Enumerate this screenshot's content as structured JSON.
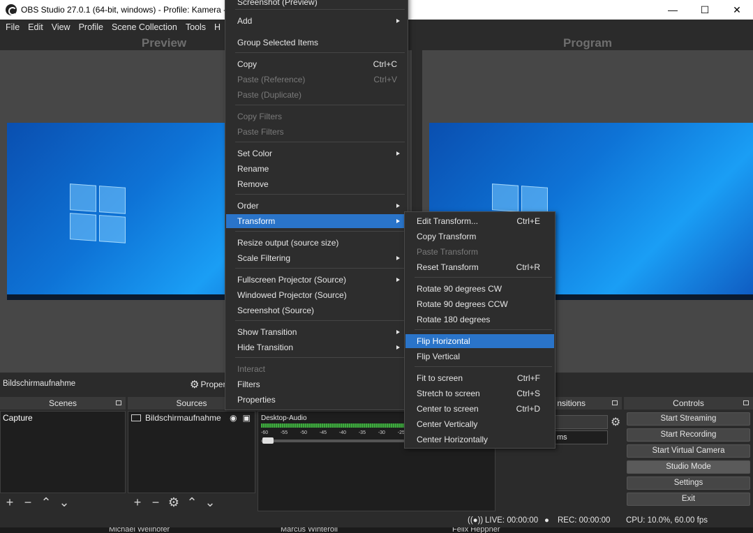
{
  "window": {
    "title": "OBS Studio 27.0.1 (64-bit, windows) - Profile: Kamera - S"
  },
  "menubar": [
    "File",
    "Edit",
    "View",
    "Profile",
    "Scene Collection",
    "Tools",
    "H"
  ],
  "panels": {
    "preview": "Preview",
    "program": "Program"
  },
  "scene_bar": {
    "scene_name": "Bildschirmaufnahme",
    "properties": "Proper"
  },
  "docks": {
    "scenes": {
      "title": "Scenes",
      "items": [
        "Capture"
      ]
    },
    "sources": {
      "title": "Sources",
      "items": [
        "Bildschirmaufnahme"
      ]
    },
    "mixer": {
      "channel": "Desktop-Audio",
      "ticks": [
        "-60",
        "-55",
        "-50",
        "-45",
        "-40",
        "-35",
        "-30",
        "-25"
      ]
    },
    "transitions": {
      "title": "nsitions",
      "value": "ms"
    },
    "controls": {
      "title": "Controls",
      "buttons": [
        "Start Streaming",
        "Start Recording",
        "Start Virtual Camera",
        "Studio Mode",
        "Settings",
        "Exit"
      ]
    }
  },
  "status": {
    "live": "LIVE: 00:00:00",
    "rec": "REC: 00:00:00",
    "cpu": "CPU: 10.0%, 60.00 fps"
  },
  "behind": [
    "Michael Wellhöfer",
    "Marcus Winteroll",
    "Felix Heppner"
  ],
  "context_menu": {
    "items": [
      {
        "label": "Screenshot (Preview)"
      },
      {
        "label": "Add"
      },
      {
        "label": "Group Selected Items"
      },
      {
        "label": "Copy",
        "shortcut": "Ctrl+C"
      },
      {
        "label": "Paste (Reference)",
        "shortcut": "Ctrl+V"
      },
      {
        "label": "Paste (Duplicate)"
      },
      {
        "label": "Copy Filters"
      },
      {
        "label": "Paste Filters"
      },
      {
        "label": "Set Color"
      },
      {
        "label": "Rename"
      },
      {
        "label": "Remove"
      },
      {
        "label": "Order"
      },
      {
        "label": "Transform"
      },
      {
        "label": "Resize output (source size)"
      },
      {
        "label": "Scale Filtering"
      },
      {
        "label": "Fullscreen Projector (Source)"
      },
      {
        "label": "Windowed Projector (Source)"
      },
      {
        "label": "Screenshot (Source)"
      },
      {
        "label": "Show Transition"
      },
      {
        "label": "Hide Transition"
      },
      {
        "label": "Interact"
      },
      {
        "label": "Filters"
      },
      {
        "label": "Properties"
      }
    ]
  },
  "transform_menu": {
    "items": [
      {
        "label": "Edit Transform...",
        "shortcut": "Ctrl+E"
      },
      {
        "label": "Copy Transform"
      },
      {
        "label": "Paste Transform"
      },
      {
        "label": "Reset Transform",
        "shortcut": "Ctrl+R"
      },
      {
        "label": "Rotate 90 degrees CW"
      },
      {
        "label": "Rotate 90 degrees CCW"
      },
      {
        "label": "Rotate 180 degrees"
      },
      {
        "label": "Flip Horizontal"
      },
      {
        "label": "Flip Vertical"
      },
      {
        "label": "Fit to screen",
        "shortcut": "Ctrl+F"
      },
      {
        "label": "Stretch to screen",
        "shortcut": "Ctrl+S"
      },
      {
        "label": "Center to screen",
        "shortcut": "Ctrl+D"
      },
      {
        "label": "Center Vertically"
      },
      {
        "label": "Center Horizontally"
      }
    ]
  }
}
